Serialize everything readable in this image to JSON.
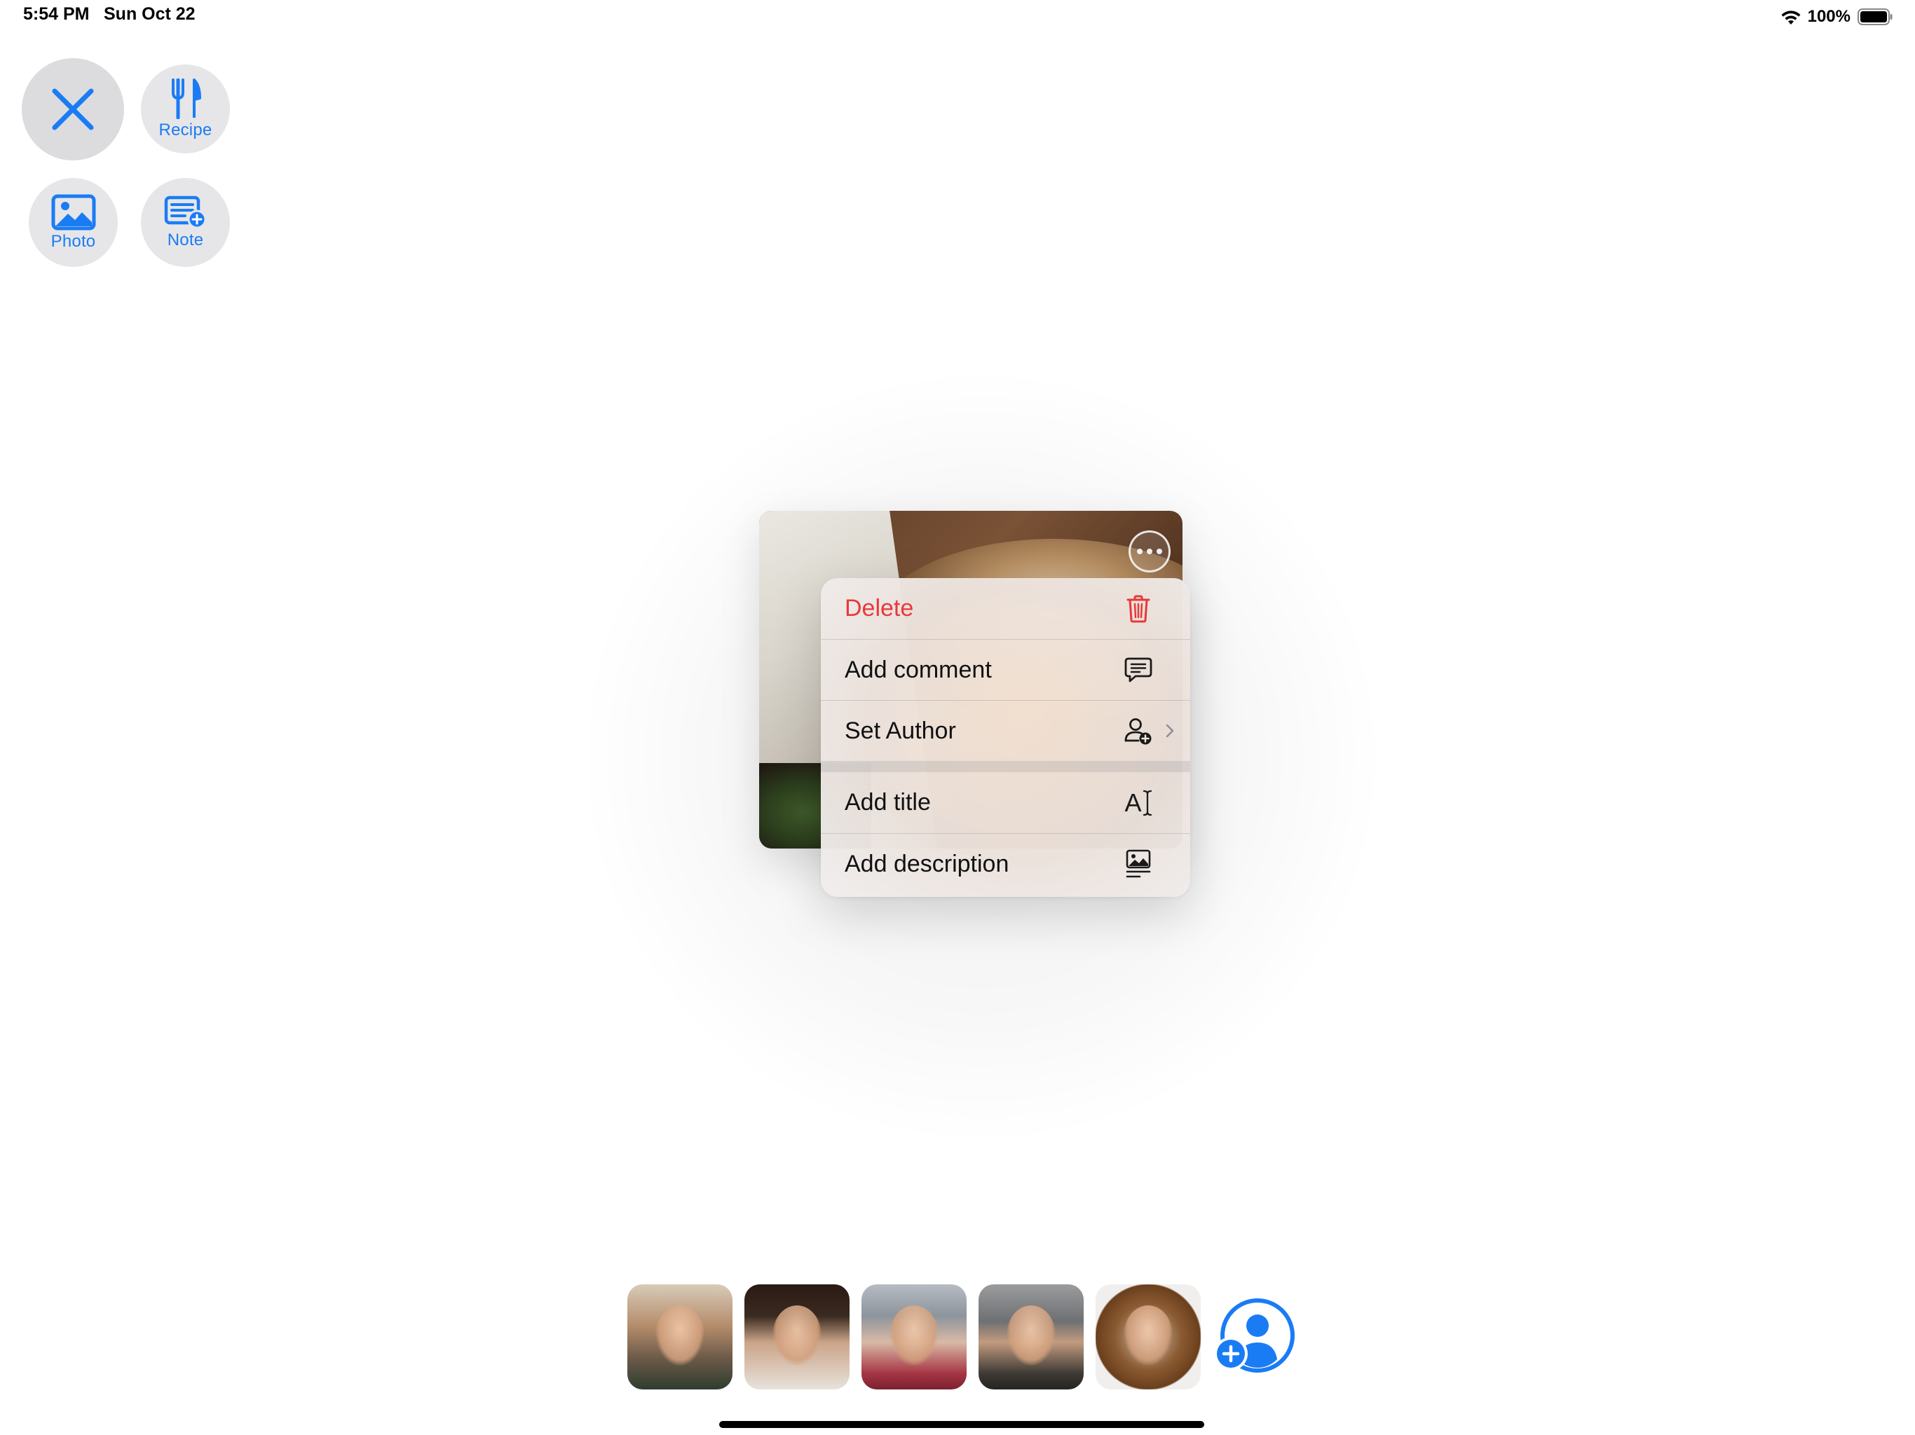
{
  "status_bar": {
    "time": "5:54 PM",
    "date": "Sun Oct 22",
    "battery": "100%"
  },
  "toolbar": {
    "close_icon": "xmark-icon",
    "recipe_label": "Recipe",
    "photo_label": "Photo",
    "note_label": "Note"
  },
  "photo_card": {
    "more_icon": "ellipsis-circle-icon"
  },
  "context_menu": {
    "items": [
      {
        "label": "Delete",
        "icon": "trash-icon",
        "destructive": true
      },
      {
        "label": "Add comment",
        "icon": "text-bubble-icon"
      },
      {
        "label": "Set Author",
        "icon": "person-badge-plus-icon",
        "submenu": true
      },
      {
        "label": "Add title",
        "icon": "textformat-cursor-icon",
        "icon_text": "A"
      },
      {
        "label": "Add description",
        "icon": "photo-text-icon"
      }
    ]
  },
  "participants": {
    "count_shown": 5,
    "add_icon": "person-add-icon"
  },
  "colors": {
    "accent": "#1a7cf5",
    "destructive": "#e8393a",
    "button_bg": "#e6e6e8"
  }
}
